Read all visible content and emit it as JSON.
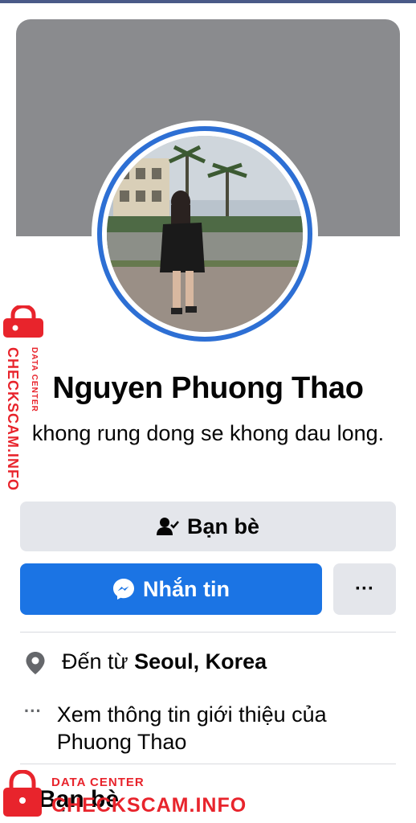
{
  "profile": {
    "name": "Nguyen Phuong Thao",
    "bio": "khong rung dong se khong dau long."
  },
  "actions": {
    "friends_label": "Bạn bè",
    "message_label": "Nhắn tin",
    "more_label": "···"
  },
  "intro": {
    "location_prefix": "Đến từ ",
    "location_value": "Seoul, Korea",
    "about_text": "Xem thông tin giới thiệu của Phuong Thao",
    "about_icon_glyph": "···"
  },
  "sections": {
    "friends_title": "Bạn bè"
  },
  "watermark": {
    "small": "DATA CENTER",
    "big": "CHECKSCAM.INFO"
  },
  "colors": {
    "accent": "#1b74e4",
    "ring": "#2d6fd4",
    "watermark": "#e8242c",
    "secondary_button": "#e4e6eb"
  },
  "icons": [
    "friends-check-icon",
    "messenger-icon",
    "more-icon",
    "location-pin-icon",
    "more-dots-icon",
    "lock-icon"
  ]
}
